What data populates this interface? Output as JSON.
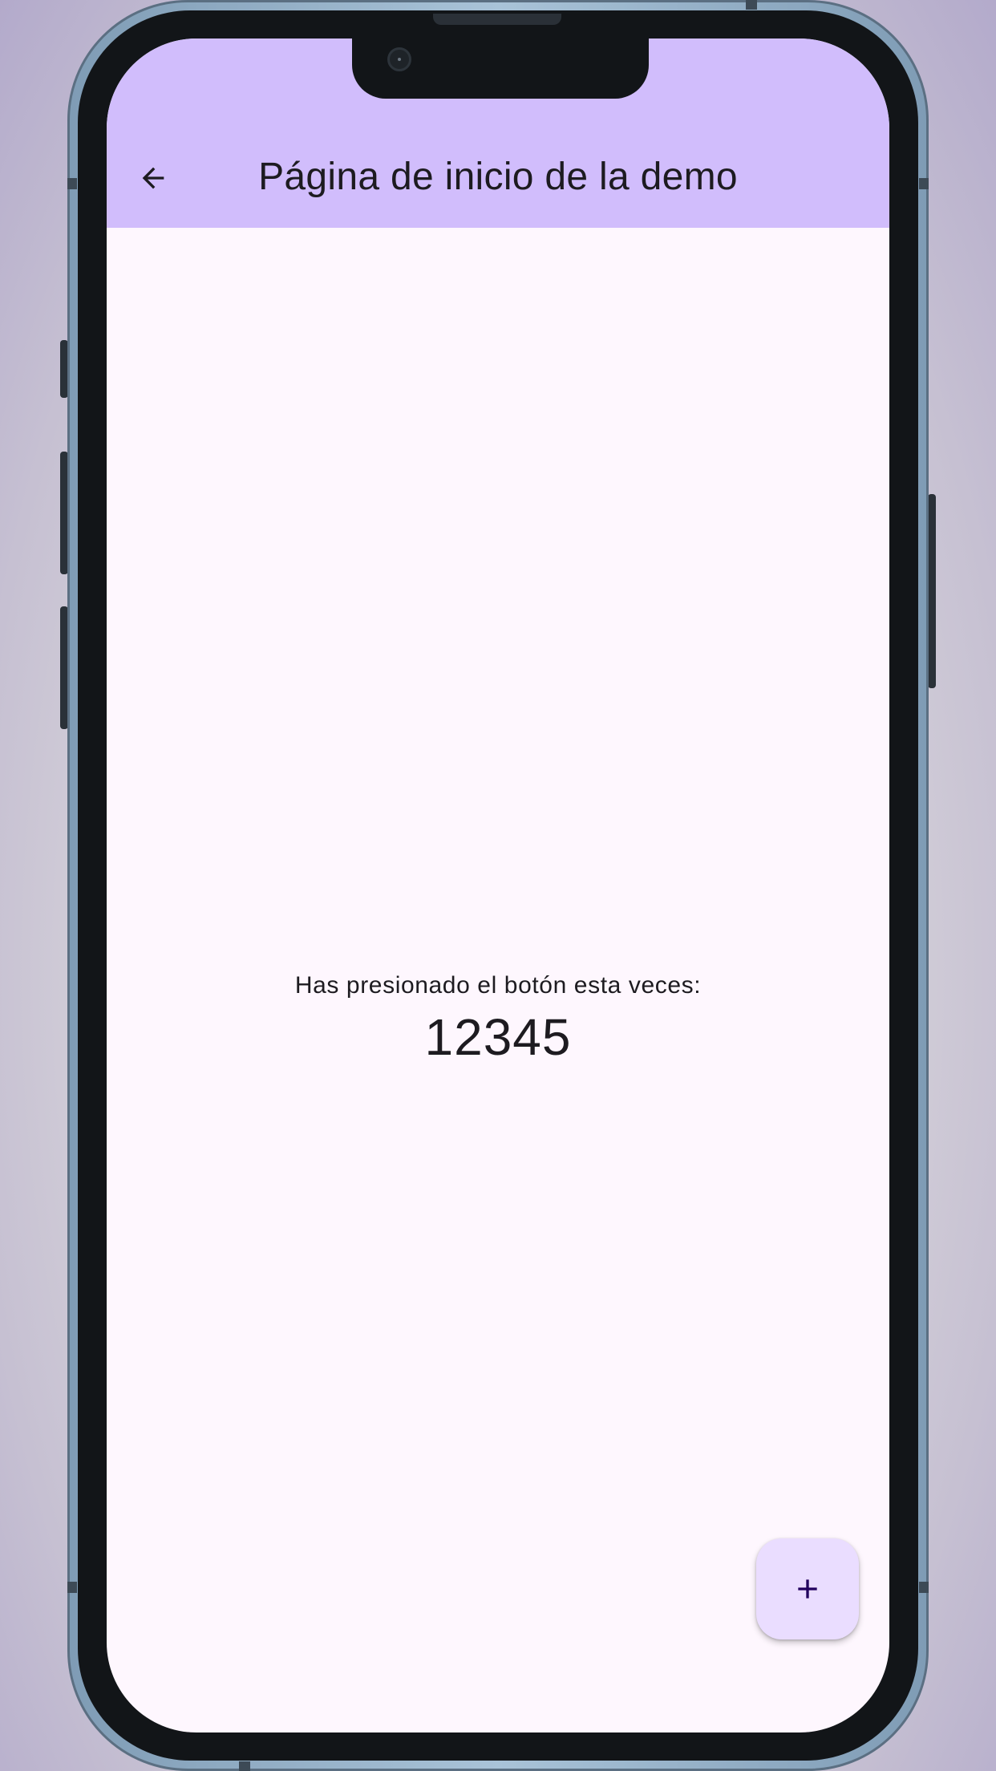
{
  "app_bar": {
    "title": "Página de inicio de la demo",
    "back_icon": "arrow-back-icon"
  },
  "body": {
    "counter_label": "Has presionado el botón esta veces:",
    "counter_value": "12345"
  },
  "fab": {
    "icon": "plus-icon"
  },
  "colors": {
    "app_bar_bg": "#d1bdfc",
    "screen_bg": "#fef7fe",
    "fab_bg": "#eaddff",
    "text": "#1d1b20",
    "fab_icon": "#21005d"
  }
}
